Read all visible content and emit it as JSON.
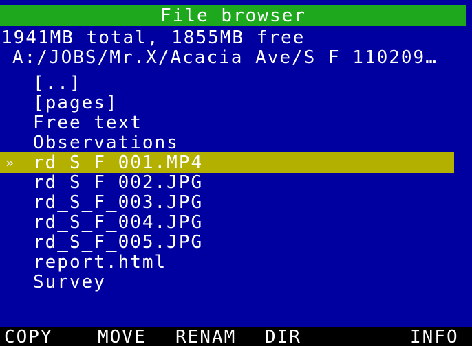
{
  "title": "File browser",
  "storage_info": "1941MB total, 1855MB free",
  "current_path": "A:/JOBS/Mr.X/Acacia Ave/S_F_110209…",
  "selection_marker": "»",
  "files": [
    {
      "name": "[..]",
      "selected": false
    },
    {
      "name": "[pages]",
      "selected": false
    },
    {
      "name": "Free text",
      "selected": false
    },
    {
      "name": "Observations",
      "selected": false
    },
    {
      "name": "rd_S_F_001.MP4",
      "selected": true
    },
    {
      "name": "rd_S_F_002.JPG",
      "selected": false
    },
    {
      "name": "rd_S_F_003.JPG",
      "selected": false
    },
    {
      "name": "rd_S_F_004.JPG",
      "selected": false
    },
    {
      "name": "rd_S_F_005.JPG",
      "selected": false
    },
    {
      "name": "report.html",
      "selected": false
    },
    {
      "name": "Survey",
      "selected": false
    }
  ],
  "softkeys": {
    "copy": "COPY",
    "move": "MOVE",
    "renam": "RENAM",
    "dir": "DIR",
    "info": "INFO"
  },
  "colors": {
    "background": "#0000a0",
    "title_bar": "#1ea81e",
    "selection": "#b4b000",
    "softkey_bar": "#000000",
    "text": "#ffffff"
  }
}
